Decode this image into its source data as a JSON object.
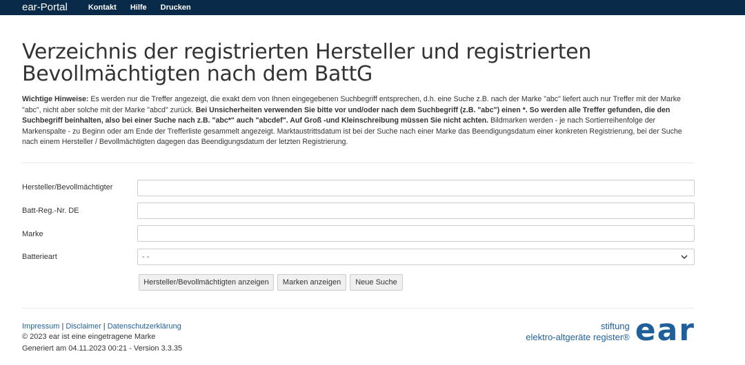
{
  "navbar": {
    "brand": "ear-Portal",
    "links": [
      "Kontakt",
      "Hilfe",
      "Drucken"
    ]
  },
  "page": {
    "title": "Verzeichnis der registrierten Hersteller und registrierten Bevollmächtigten nach dem BattG"
  },
  "notice": {
    "label": "Wichtige Hinweise:",
    "text1": " Es werden nur die Treffer angezeigt, die exakt dem von Ihnen eingegebenen Suchbegriff entsprechen, d.h. eine Suche z.B. nach der Marke \"abc\" liefert auch nur Treffer mit der Marke \"abc\", nicht aber solche mit der Marke \"abcd\" zurück. ",
    "bold": "Bei Unsicherheiten verwenden Sie bitte vor und/oder nach dem Suchbegriff (z.B. \"abc\") einen *. So werden alle Treffer gefunden, die den Suchbegriff beinhalten, also bei einer Suche nach z.B. \"abc*\" auch \"abcdef\". Auf Groß -und Kleinschreibung müssen Sie nicht achten.",
    "text2": " Bildmarken werden - je nach Sortierreihenfolge der Markenspalte - zu Beginn oder am Ende der Trefferliste gesammelt angezeigt. Marktaustrittsdatum ist bei der Suche nach einer Marke das Beendigungsdatum einer konkreten Registrierung, bei der Suche nach einem Hersteller / Bevollmächtigten dagegen das Beendigungsdatum der letzten Registrierung."
  },
  "form": {
    "manufacturer_label": "Hersteller/Bevollmächtigter",
    "manufacturer_value": "",
    "regnr_label": "Batt-Reg.-Nr. DE",
    "regnr_value": "",
    "brand_label": "Marke",
    "brand_value": "",
    "battery_type_label": "Batterieart",
    "battery_type_value": "- -"
  },
  "buttons": {
    "show_manufacturers": "Hersteller/Bevollmächtigten anzeigen",
    "show_brands": "Marken anzeigen",
    "new_search": "Neue Suche"
  },
  "footer": {
    "impressum": "Impressum",
    "disclaimer": "Disclaimer",
    "privacy": "Datenschutzerklärung",
    "separator": "|",
    "copyright": "© 2023 ear ist eine eingetragene Marke",
    "generated": "Generiert am 04.11.2023 00:21 - Version 3.3.35"
  },
  "logo": {
    "line1": "stiftung",
    "line2": "elektro-altgeräte register®",
    "mark": "ear"
  },
  "colors": {
    "navbar": "#0a2a4a",
    "link": "#1f5f9a",
    "text": "#333333"
  }
}
